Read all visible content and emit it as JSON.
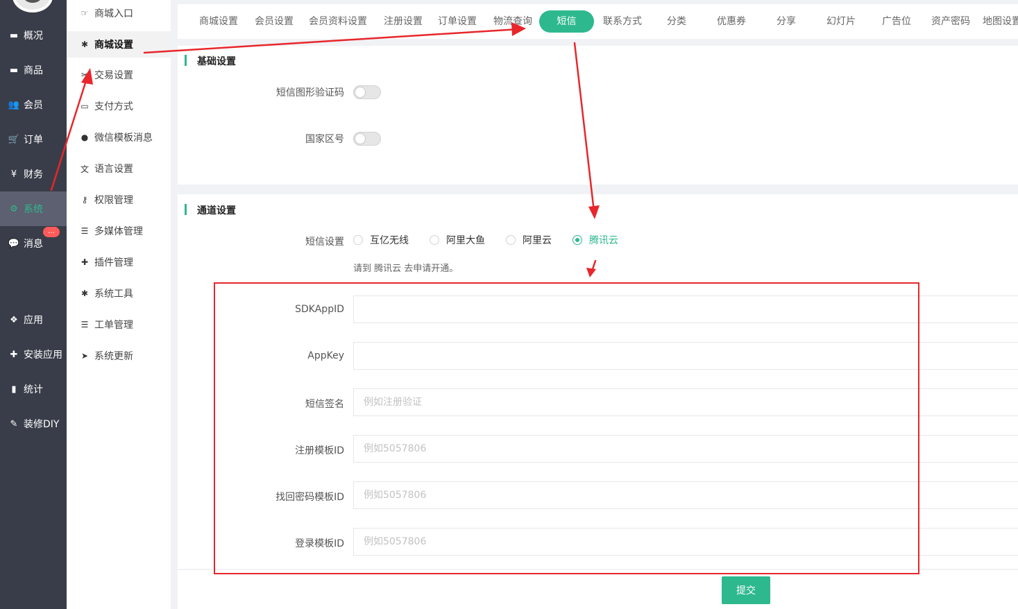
{
  "sidebar": {
    "items": [
      {
        "label": "概况",
        "icon": "dashboard-icon",
        "glyph": "▬"
      },
      {
        "label": "商品",
        "icon": "goods-icon",
        "glyph": "▬"
      },
      {
        "label": "会员",
        "icon": "users-icon",
        "glyph": "👥"
      },
      {
        "label": "订单",
        "icon": "cart-icon",
        "glyph": "🛒"
      },
      {
        "label": "财务",
        "icon": "yen-icon",
        "glyph": "¥"
      },
      {
        "label": "系统",
        "icon": "cogs-icon",
        "glyph": "⚙"
      },
      {
        "label": "消息",
        "icon": "chat-icon",
        "glyph": "💬"
      },
      {
        "label": "应用",
        "icon": "cubes-icon",
        "glyph": "❖"
      },
      {
        "label": "安装应用",
        "icon": "puzzle-icon",
        "glyph": "✚"
      },
      {
        "label": "统计",
        "icon": "bar-chart-icon",
        "glyph": "▮"
      },
      {
        "label": "装修DIY",
        "icon": "gavel-icon",
        "glyph": "✎"
      }
    ],
    "active": "系统",
    "message_badge": "..."
  },
  "submenu": {
    "items": [
      {
        "label": "商城入口",
        "icon": "hand-pointer-icon",
        "glyph": "☞"
      },
      {
        "label": "商城设置",
        "icon": "gear-icon",
        "glyph": "✱"
      },
      {
        "label": "交易设置",
        "icon": "tools-icon",
        "glyph": "✂"
      },
      {
        "label": "支付方式",
        "icon": "credit-card-icon",
        "glyph": "▭"
      },
      {
        "label": "微信模板消息",
        "icon": "wechat-icon",
        "glyph": "●"
      },
      {
        "label": "语言设置",
        "icon": "language-icon",
        "glyph": "文"
      },
      {
        "label": "权限管理",
        "icon": "key-icon",
        "glyph": "⚷"
      },
      {
        "label": "多媒体管理",
        "icon": "list-icon",
        "glyph": "☰"
      },
      {
        "label": "插件管理",
        "icon": "plugin-icon",
        "glyph": "✚"
      },
      {
        "label": "系统工具",
        "icon": "cog-icon",
        "glyph": "✱"
      },
      {
        "label": "工单管理",
        "icon": "list-icon",
        "glyph": "☰"
      },
      {
        "label": "系统更新",
        "icon": "paper-plane-icon",
        "glyph": "➤"
      }
    ],
    "active": "商城设置"
  },
  "tabs": {
    "items": [
      "商城设置",
      "会员设置",
      "会员资料设置",
      "注册设置",
      "订单设置",
      "物流查询",
      "短信",
      "联系方式",
      "分类",
      "优惠券",
      "分享",
      "幻灯片",
      "广告位",
      "资产密码",
      "地图设置"
    ],
    "active": "短信"
  },
  "basic_section": {
    "title": "基础设置",
    "sms_captcha_label": "短信图形验证码",
    "sms_captcha_enabled": false,
    "country_code_label": "国家区号",
    "country_code_enabled": false
  },
  "channel_section": {
    "title": "通道设置",
    "provider_label": "短信设置",
    "providers": [
      "互亿无线",
      "阿里大鱼",
      "阿里云",
      "腾讯云"
    ],
    "selected_provider": "腾讯云",
    "hint": "请到 腾讯云 去申请开通。",
    "fields": [
      {
        "label": "SDKAppID",
        "value": "",
        "placeholder": ""
      },
      {
        "label": "AppKey",
        "value": "",
        "placeholder": ""
      },
      {
        "label": "短信签名",
        "value": "",
        "placeholder": "例如注册验证"
      },
      {
        "label": "注册模板ID",
        "value": "",
        "placeholder": "例如5057806"
      },
      {
        "label": "找回密码模板ID",
        "value": "",
        "placeholder": "例如5057806"
      },
      {
        "label": "登录模板ID",
        "value": "",
        "placeholder": "例如5057806"
      }
    ]
  },
  "footer": {
    "submit_label": "提交"
  },
  "colors": {
    "accent": "#2eb88e",
    "sidebar_bg": "#393d49",
    "annotation": "#e8262b",
    "badge": "#ff5b5b"
  }
}
